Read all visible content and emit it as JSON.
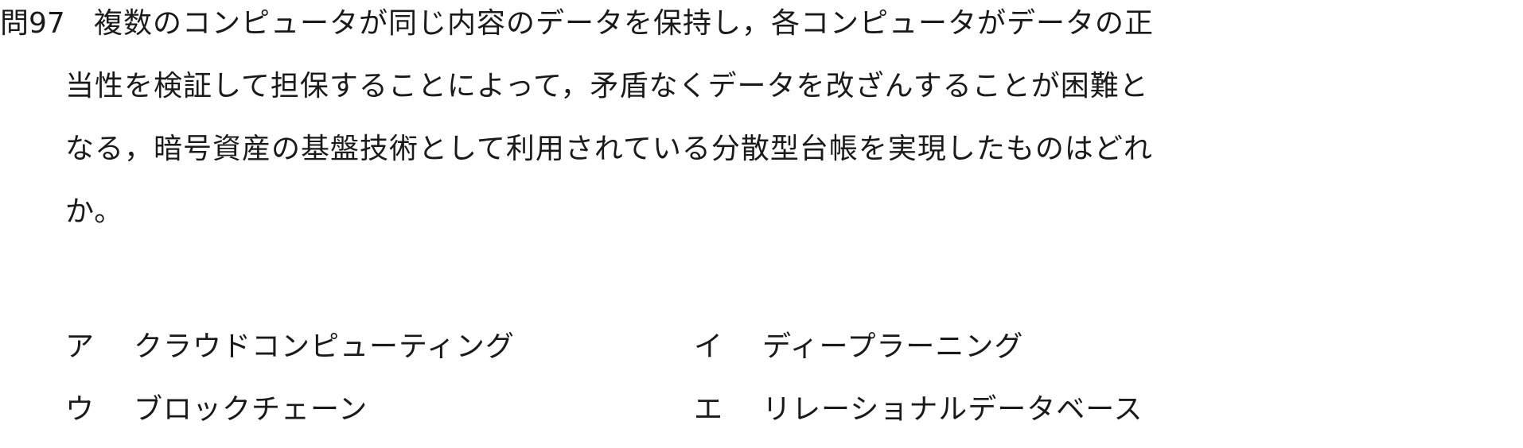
{
  "question": {
    "number": "問97",
    "lines": [
      "複数のコンピュータが同じ内容のデータを保持し，各コンピュータがデータの正",
      "当性を検証して担保することによって，矛盾なくデータを改ざんすることが困難と",
      "なる，暗号資産の基盤技術として利用されている分散型台帳を実現したものはどれ",
      "か。"
    ]
  },
  "choices": [
    {
      "letter": "ア",
      "text": "クラウドコンピューティング"
    },
    {
      "letter": "イ",
      "text": "ディープラーニング"
    },
    {
      "letter": "ウ",
      "text": "ブロックチェーン"
    },
    {
      "letter": "エ",
      "text": "リレーショナルデータベース"
    }
  ]
}
